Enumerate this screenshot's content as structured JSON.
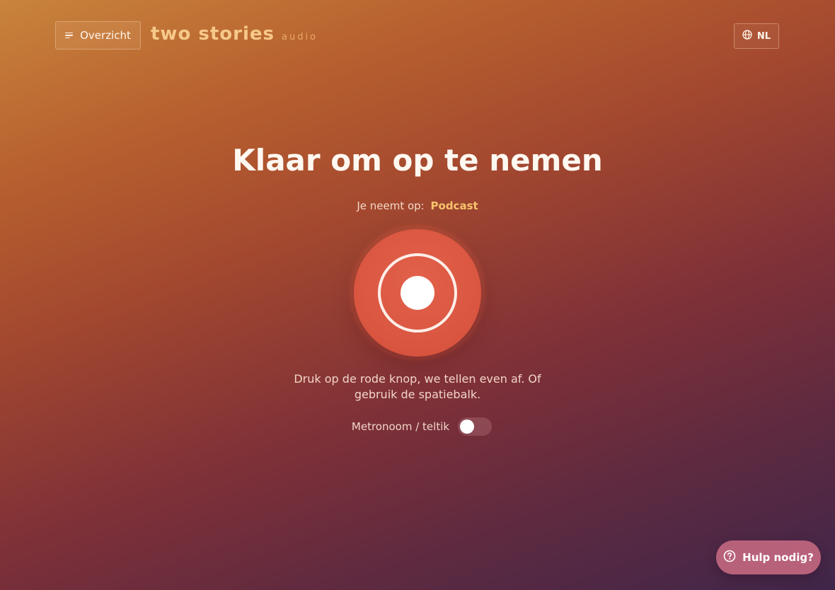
{
  "header": {
    "menu_label": "Overzicht",
    "logo_main": "two stories",
    "logo_sub": "audio",
    "language": "NL"
  },
  "main": {
    "title": "Klaar om op te nemen",
    "recording_label": "Je neemt op:",
    "recording_type": "Podcast",
    "instruction": "Druk op de rode knop, we tellen even af. Of gebruik de spatiebalk.",
    "metronome_label": "Metronoom / teltik",
    "metronome_enabled": false
  },
  "help": {
    "label": "Hulp nodig?"
  },
  "icons": {
    "menu": "menu-lines-icon",
    "language": "globe-icon",
    "help": "question-circle-icon"
  },
  "colors": {
    "record_button": "#d9553f",
    "accent": "#f7c36c",
    "help_button": "#b8617a"
  }
}
